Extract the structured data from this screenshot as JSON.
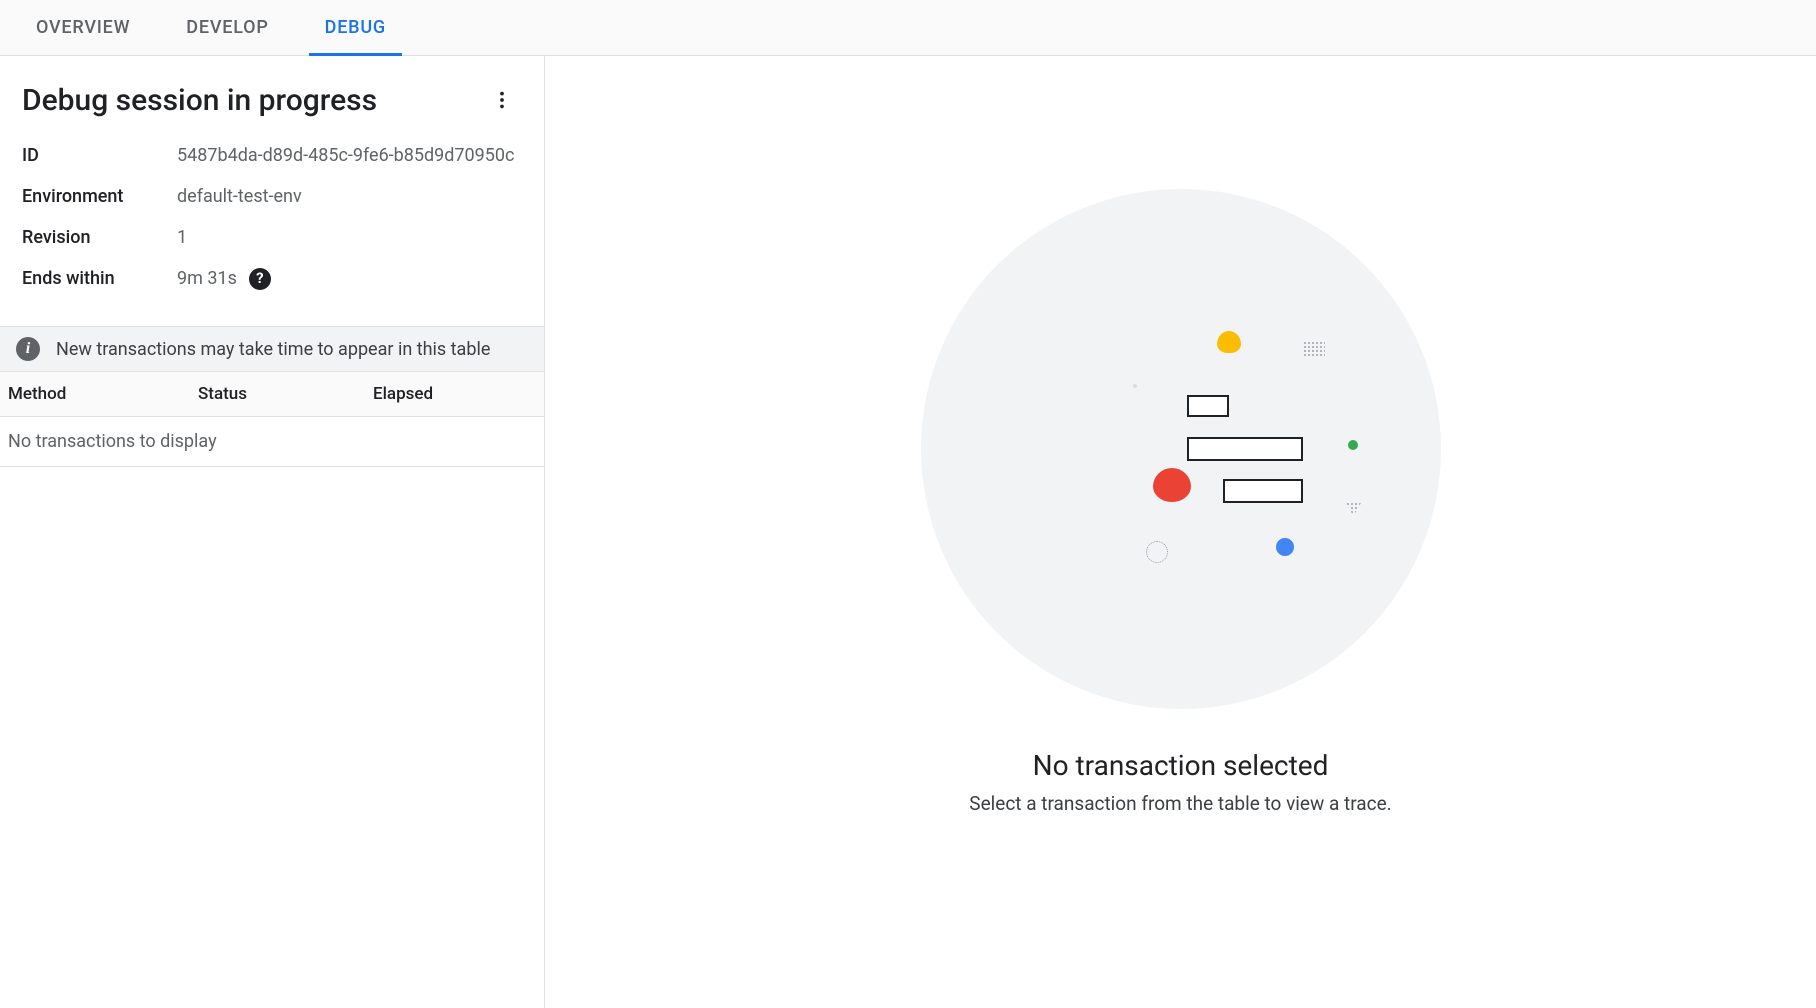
{
  "tabs": {
    "overview": "OVERVIEW",
    "develop": "DEVELOP",
    "debug": "DEBUG"
  },
  "session": {
    "title": "Debug session in progress",
    "fields": {
      "id_label": "ID",
      "id_value": "5487b4da-d89d-485c-9fe6-b85d9d70950c",
      "env_label": "Environment",
      "env_value": "default-test-env",
      "rev_label": "Revision",
      "rev_value": "1",
      "ends_label": "Ends within",
      "ends_value": "9m 31s"
    }
  },
  "banner": {
    "text": "New transactions may take time to appear in this table"
  },
  "table": {
    "headers": {
      "method": "Method",
      "status": "Status",
      "elapsed": "Elapsed"
    },
    "empty": "No transactions to display"
  },
  "right": {
    "title": "No transaction selected",
    "subtitle": "Select a transaction from the table to view a trace."
  },
  "icons": {
    "help_glyph": "?",
    "info_glyph": "i"
  }
}
